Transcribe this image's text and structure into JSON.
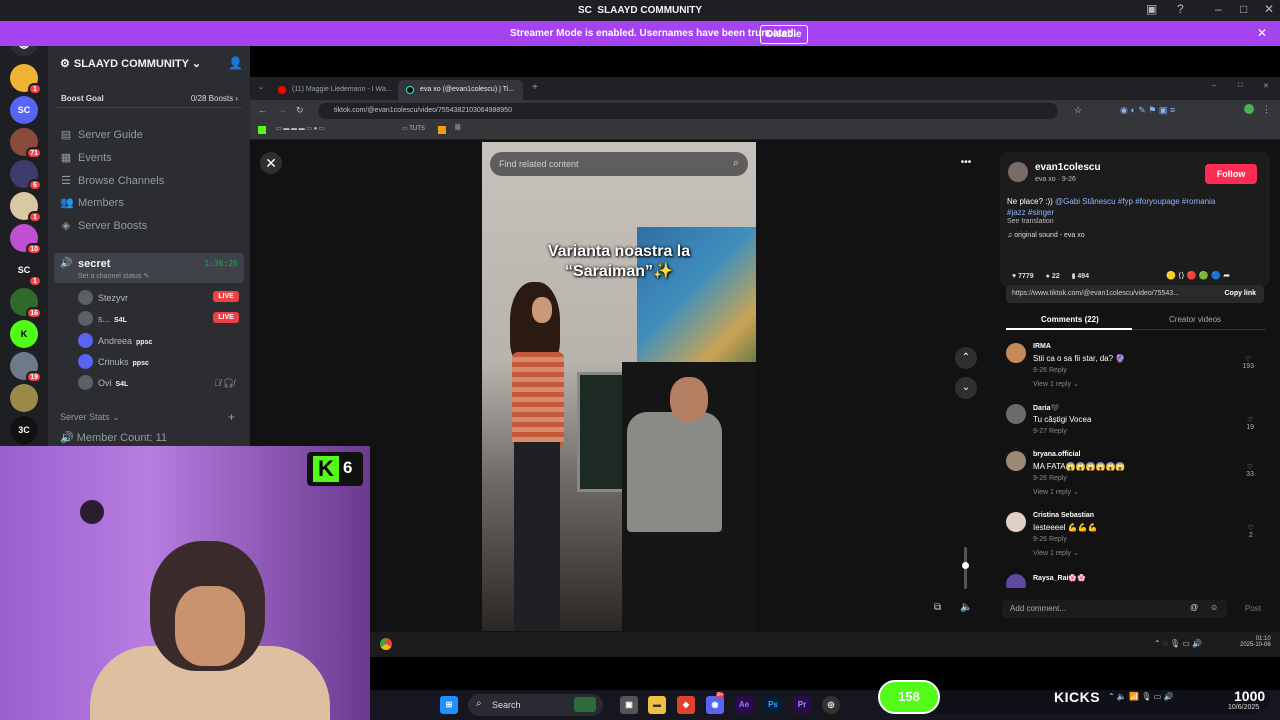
{
  "window": {
    "title": "SLAAYD COMMUNITY",
    "logo": "SC"
  },
  "banner": {
    "message": "Streamer Mode is enabled. Usernames have been truncated.",
    "button": "Disable"
  },
  "rail": {
    "servers": [
      {
        "label": "",
        "badge": "1",
        "color": "#f0b232"
      },
      {
        "label": "SC",
        "badge": "",
        "color": "#5865f2"
      },
      {
        "label": "",
        "badge": "71",
        "color": "#8a4b3a"
      },
      {
        "label": "",
        "badge": "6",
        "color": "#3d3d6b"
      },
      {
        "label": "",
        "badge": "1",
        "color": "#d9c9a3"
      },
      {
        "label": "",
        "badge": "10",
        "color": "#c04fd4"
      },
      {
        "label": "SC",
        "badge": "1",
        "color": "#1e1f22"
      },
      {
        "label": "",
        "badge": "16",
        "color": "#2f6a2a"
      },
      {
        "label": "K",
        "badge": "",
        "color": "#53fc18"
      },
      {
        "label": "",
        "badge": "19",
        "color": "#6d7a8a"
      },
      {
        "label": "",
        "badge": "",
        "color": "#9a8a4a"
      },
      {
        "label": "3C",
        "badge": "",
        "color": "#111111"
      }
    ]
  },
  "sidebar": {
    "server_name": "SLAAYD COMMUNITY",
    "boost_goal": "Boost Goal",
    "boost_count": "0/28 Boosts",
    "nav": [
      "Server Guide",
      "Events",
      "Browse Channels",
      "Members",
      "Server Boosts"
    ],
    "voice_channel": {
      "name": "secret",
      "time": "1:36:26",
      "status": "Set a channel status"
    },
    "voice_users": [
      {
        "name": "Stezyvr",
        "tag": "",
        "live": "LIVE"
      },
      {
        "name": "s...",
        "tag": "S4L",
        "live": "LIVE"
      },
      {
        "name": "Andreea",
        "tag": "ppsc",
        "live": ""
      },
      {
        "name": "Crinuks",
        "tag": "ppsc",
        "live": ""
      },
      {
        "name": "Ovi",
        "tag": "S4L",
        "live": ""
      }
    ],
    "category": "Server Stats",
    "member_count": "Member Count: 11"
  },
  "browser": {
    "tabs": [
      {
        "label": "(11) Maggie Liedemann - I Wa...",
        "active": false
      },
      {
        "label": "eva xo (@evan1colescu) | Ti...",
        "active": true
      }
    ],
    "url": "tiktok.com/@evan1colescu/video/7554382103064988950",
    "bookmark_folder": "TUTS"
  },
  "tiktok": {
    "search_placeholder": "Find related content",
    "caption_line1": "Varianta noastra la",
    "caption_line2": "“Saraiman”✨",
    "author": {
      "username": "evan1colescu",
      "sub": "eva xo · 9-26",
      "follow": "Follow",
      "desc": "Ne place? :))",
      "mention": "@Gabi Stănescu",
      "hashtags": "#fyp #foryoupage #romania",
      "hashtags2": "#jazz #singer",
      "translation": "See translation",
      "sound": "original sound - eva xo"
    },
    "stats": {
      "likes": "7779",
      "comments": "22",
      "saves": "494"
    },
    "link": "https://www.tiktok.com/@evan1colescu/video/75543...",
    "copy_link": "Copy link",
    "tab_comments": "Comments (22)",
    "tab_creator": "Creator videos",
    "comments": [
      {
        "user": "IRMA",
        "text": "Stii ca o sa fii star, da? 🔮",
        "meta": "9-26    Reply",
        "replies": "View 1 reply ⌄",
        "likes": "193"
      },
      {
        "user": "Daria🖤",
        "text": "Tu câștigi Vocea",
        "meta": "9-27    Reply",
        "replies": "",
        "likes": "19"
      },
      {
        "user": "bryana.official",
        "text": "MA FATA😱😱😱😱😱😱",
        "meta": "9-26    Reply",
        "replies": "View 1 reply ⌄",
        "likes": "33"
      },
      {
        "user": "Cristina Sebastian",
        "text": "Iesteeeel 💪💪💪",
        "meta": "9-26    Reply",
        "replies": "View 1 reply ⌄",
        "likes": "2"
      },
      {
        "user": "Raysa_Rai🌸🌸",
        "text": "",
        "meta": "",
        "replies": "",
        "likes": ""
      }
    ],
    "add_comment": "Add comment...",
    "post": "Post"
  },
  "inner_clock": {
    "time": "01:10",
    "date": "2025-10-06"
  },
  "webcam": {
    "kick_count": "6",
    "kick_letter": "K"
  },
  "taskbar": {
    "search": "Search",
    "discord_badge": "9+"
  },
  "kicks": {
    "current": "158",
    "label": "KICKS",
    "goal": "1000",
    "date": "10/6/2025"
  },
  "colors": {
    "discord_bg": "#2b2d31",
    "streamer_banner": "#a643f0",
    "tiktok_follow": "#fe2c55",
    "kick_green": "#53fc18",
    "live_red": "#ed4245"
  }
}
